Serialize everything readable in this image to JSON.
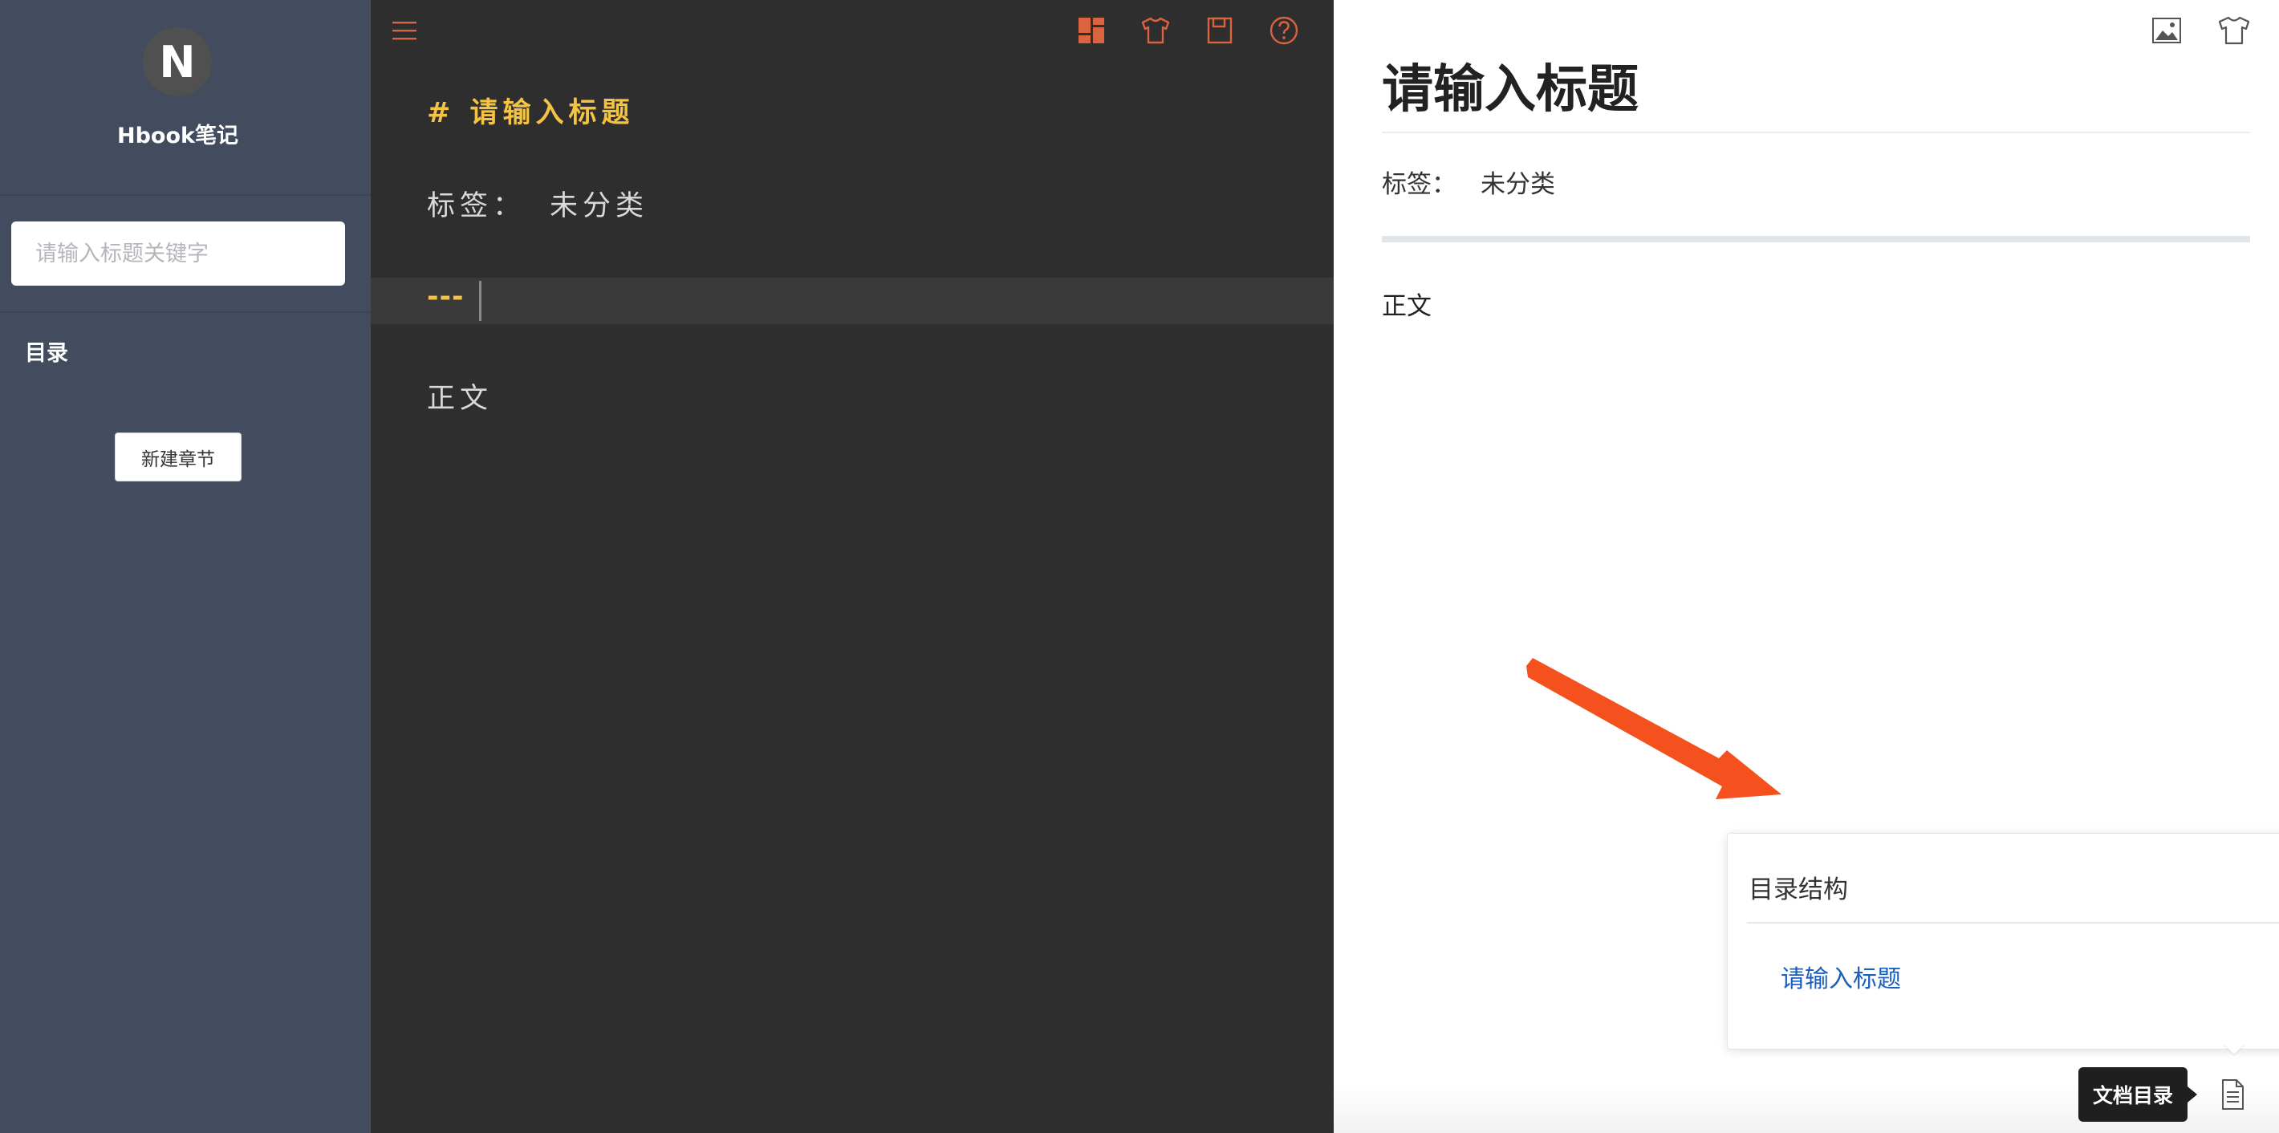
{
  "sidebar": {
    "logo_letter": "N",
    "app_title": "Hbook笔记",
    "search_placeholder": "请输入标题关键字",
    "toc_label": "目录",
    "new_chapter_button": "新建章节"
  },
  "editor": {
    "toolbar_icons": [
      "menu-icon",
      "layout-icon",
      "theme-shirt-icon",
      "save-icon",
      "help-icon"
    ],
    "heading_line": "# 请输入标题",
    "tags_label": "标签：",
    "tags_value": "未分类",
    "hr_line": "---",
    "body_line": "正文"
  },
  "preview": {
    "toolbar_icons": [
      "image-icon",
      "theme-shirt-icon"
    ],
    "title": "请输入标题",
    "tags_label": "标签：",
    "tags_value": "未分类",
    "body": "正文"
  },
  "toc_popover": {
    "title": "目录结构",
    "items": [
      "请输入标题"
    ]
  },
  "doc_toc_tooltip": "文档目录",
  "colors": {
    "sidebar_bg": "#434c5e",
    "editor_bg": "#2e2e2e",
    "editor_accent": "#f5c344",
    "editor_icon": "#d9643f",
    "toc_link": "#1a5fc0",
    "annotation_arrow": "#f4511e"
  }
}
